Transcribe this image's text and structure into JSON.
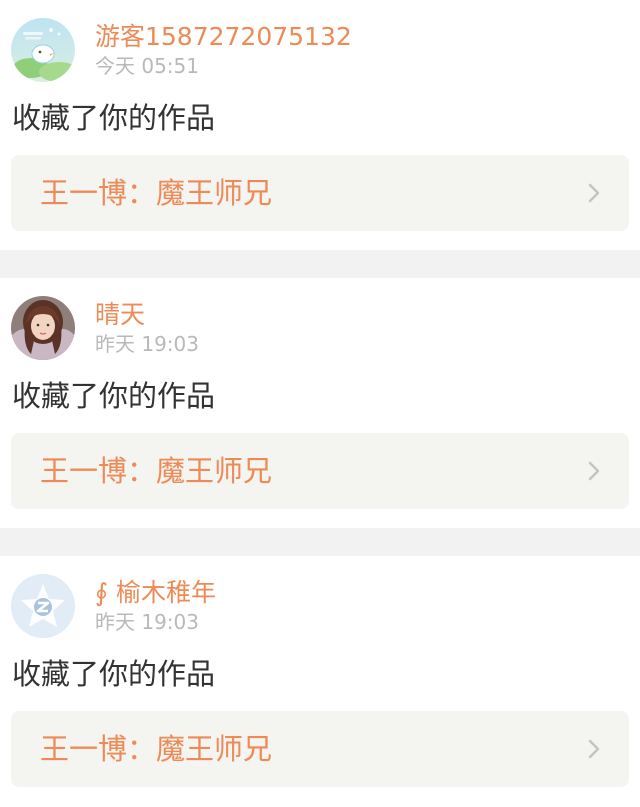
{
  "notifications": [
    {
      "username": "游客1587272075132",
      "time": "今天 05:51",
      "action": "收藏了你的作品",
      "work_title": "王一博：魔王师兄",
      "avatar_icon": "cartoon-bird-avatar"
    },
    {
      "username": "晴天",
      "time": "昨天 19:03",
      "action": "收藏了你的作品",
      "work_title": "王一博：魔王师兄",
      "avatar_icon": "photo-portrait-avatar"
    },
    {
      "username": "∮ 榆木稚年",
      "time": "昨天 19:03",
      "action": "收藏了你的作品",
      "work_title": "王一博：魔王师兄",
      "avatar_icon": "default-z-avatar"
    }
  ],
  "colors": {
    "accent": "#ee8a56",
    "time_gray": "#b9b9b9",
    "text_dark": "#333333",
    "work_bg": "#f4f4f1",
    "separator": "#f2f2f2"
  }
}
